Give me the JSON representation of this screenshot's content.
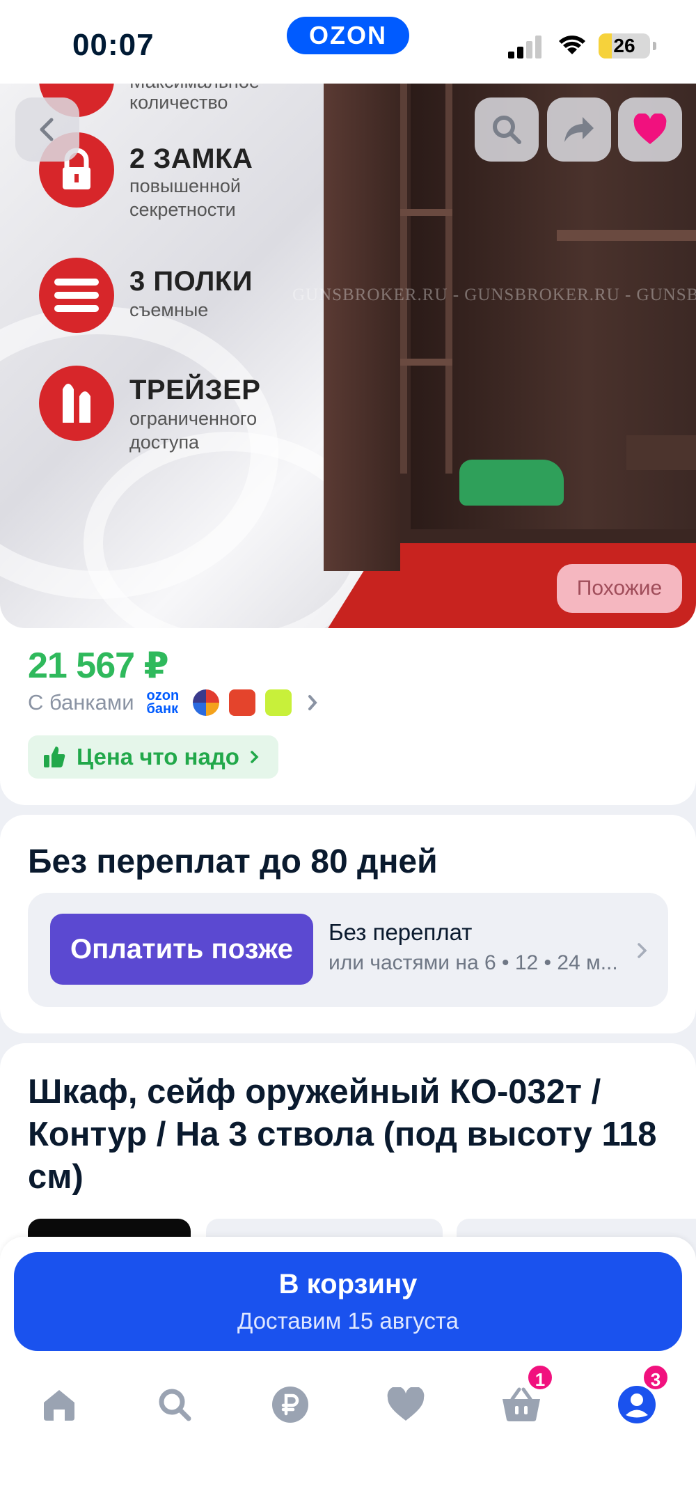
{
  "status_bar": {
    "time": "00:07",
    "app_logo": "OZON",
    "battery": "26"
  },
  "gallery": {
    "features": [
      {
        "title": "Максимальное",
        "subtitle": "количество"
      },
      {
        "title": "2 ЗАМКА",
        "subtitle": "повышенной секретности"
      },
      {
        "title": "3 ПОЛКИ",
        "subtitle": "съемные"
      },
      {
        "title": "ТРЕЙЗЕР",
        "subtitle": "ограниченного доступа"
      }
    ],
    "watermark": "GUNSBROKER.RU - GUNSBROKER.RU - GUNSBROKER.RU - GUNSBROKER.RU",
    "similar_label": "Похожие"
  },
  "price": {
    "value": "21 567 ₽",
    "with_banks_label": "С банками",
    "ozon_bank_logo": "ozon банк",
    "badge": "Цена что надо"
  },
  "bnpl": {
    "title": "Без переплат до 80 дней",
    "button": "Оплатить позже",
    "line1": "Без переплат",
    "line2": "или частями на 6 • 12 • 24 м..."
  },
  "product": {
    "title": "Шкаф, сейф оружейный КО-032т / Контур / На 3 ствола (под высоту 118 см)"
  },
  "cart": {
    "label": "В корзину",
    "delivery": "Доставим 15 августа"
  },
  "tabbar": {
    "items": [
      {
        "name": "home",
        "icon": "home-icon"
      },
      {
        "name": "search",
        "icon": "search-icon"
      },
      {
        "name": "finance",
        "icon": "ruble-icon"
      },
      {
        "name": "favorites",
        "icon": "heart-icon"
      },
      {
        "name": "cart",
        "icon": "basket-icon",
        "badge": "1"
      },
      {
        "name": "profile",
        "icon": "profile-icon",
        "badge": "3"
      }
    ]
  },
  "colors": {
    "brand_blue": "#005bff",
    "price_green": "#2fb95c",
    "pay_later_purple": "#5b49d1",
    "badge_pink": "#f1117e",
    "cart_blue": "#1a52ee"
  }
}
